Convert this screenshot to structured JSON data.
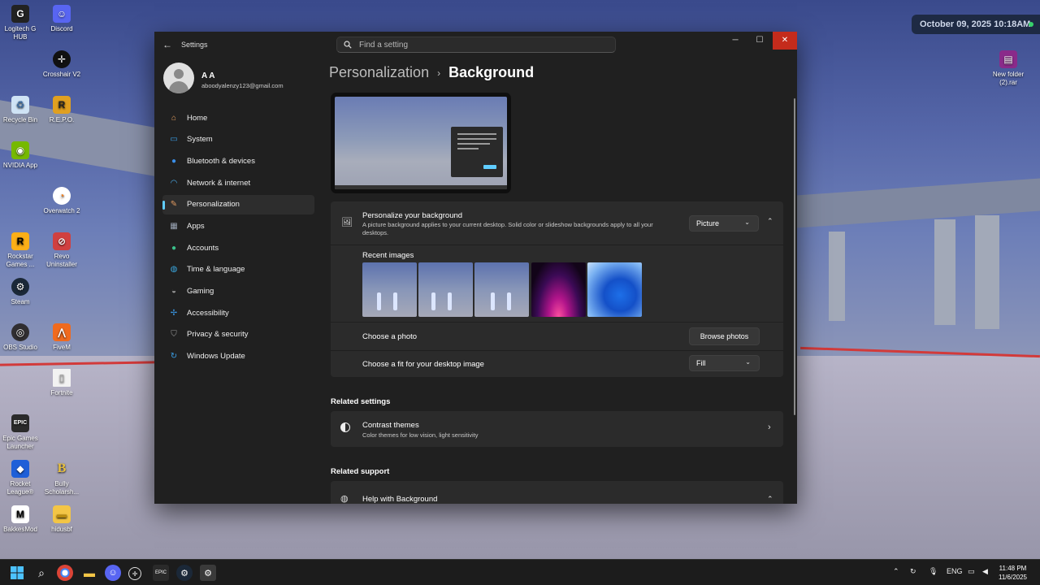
{
  "desktop": {
    "icons_left": [
      {
        "label": "Logitech G HUB",
        "icon": "logitech-icon"
      },
      {
        "label": "Discord",
        "icon": "discord-icon"
      },
      {
        "label": "Crosshair V2",
        "icon": "crosshair-icon"
      },
      {
        "label": "Recycle Bin",
        "icon": "recycle-bin-icon"
      },
      {
        "label": "R.E.P.O.",
        "icon": "repo-icon"
      },
      {
        "label": "NVIDIA App",
        "icon": "nvidia-icon"
      },
      {
        "label": "Overwatch 2",
        "icon": "overwatch-icon"
      },
      {
        "label": "Rockstar Games ...",
        "icon": "rockstar-icon"
      },
      {
        "label": "Revo Uninstaller",
        "icon": "revo-icon"
      },
      {
        "label": "Steam",
        "icon": "steam-icon"
      },
      {
        "label": "OBS Studio",
        "icon": "obs-icon"
      },
      {
        "label": "FiveM",
        "icon": "fivem-icon"
      },
      {
        "label": "Fortnite",
        "icon": "fortnite-file-icon"
      },
      {
        "label": "Epic Games Launcher",
        "icon": "epic-icon"
      },
      {
        "label": "Rocket League®",
        "icon": "rocket-league-icon"
      },
      {
        "label": "Bully Scholarsh...",
        "icon": "bully-icon"
      },
      {
        "label": "BakkesMod",
        "icon": "bakkesmod-icon"
      },
      {
        "label": "hidusbf",
        "icon": "folder-icon"
      }
    ],
    "icons_right": [
      {
        "label": "New folder (2).rar",
        "icon": "winrar-icon"
      }
    ],
    "date_widget": "October 09, 2025 10:18AM"
  },
  "window": {
    "app_title": "Settings",
    "search_placeholder": "Find a setting"
  },
  "user": {
    "name": "A A",
    "email": "aboodyalenzy123@gmail.com"
  },
  "nav": [
    {
      "label": "Home",
      "icon": "home-icon",
      "color": "#e8a060"
    },
    {
      "label": "System",
      "icon": "system-icon",
      "color": "#3aa0e8"
    },
    {
      "label": "Bluetooth & devices",
      "icon": "bluetooth-icon",
      "color": "#3a8ee8"
    },
    {
      "label": "Network & internet",
      "icon": "wifi-icon",
      "color": "#4ab0f0"
    },
    {
      "label": "Personalization",
      "icon": "brush-icon",
      "color": "#e09a60",
      "active": true
    },
    {
      "label": "Apps",
      "icon": "apps-icon",
      "color": "#9aa4b4"
    },
    {
      "label": "Accounts",
      "icon": "accounts-icon",
      "color": "#3ac08a"
    },
    {
      "label": "Time & language",
      "icon": "globe-clock-icon",
      "color": "#3aa8e0"
    },
    {
      "label": "Gaming",
      "icon": "gamepad-icon",
      "color": "#9a9a9a"
    },
    {
      "label": "Accessibility",
      "icon": "accessibility-icon",
      "color": "#3a9ae8"
    },
    {
      "label": "Privacy & security",
      "icon": "shield-icon",
      "color": "#9a9a9a"
    },
    {
      "label": "Windows Update",
      "icon": "update-icon",
      "color": "#3aa0e8"
    }
  ],
  "breadcrumb": {
    "parent": "Personalization",
    "separator": "›",
    "current": "Background"
  },
  "background": {
    "title": "Personalize your background",
    "desc": "A picture background applies to your current desktop. Solid color or slideshow backgrounds apply to all your desktops.",
    "type_value": "Picture",
    "recent_label": "Recent images",
    "choose_photo_label": "Choose a photo",
    "browse_label": "Browse photos",
    "fit_label": "Choose a fit for your desktop image",
    "fit_value": "Fill"
  },
  "related_settings": {
    "heading": "Related settings",
    "contrast_title": "Contrast themes",
    "contrast_desc": "Color themes for low vision, light sensitivity"
  },
  "related_support": {
    "heading": "Related support",
    "help_title": "Help with Background"
  },
  "taskbar": {
    "lang": "ENG",
    "time": "11:48 PM",
    "date": "11/6/2025"
  },
  "colors": {
    "accent": "#60cdff",
    "close_red": "#c42b1c"
  }
}
